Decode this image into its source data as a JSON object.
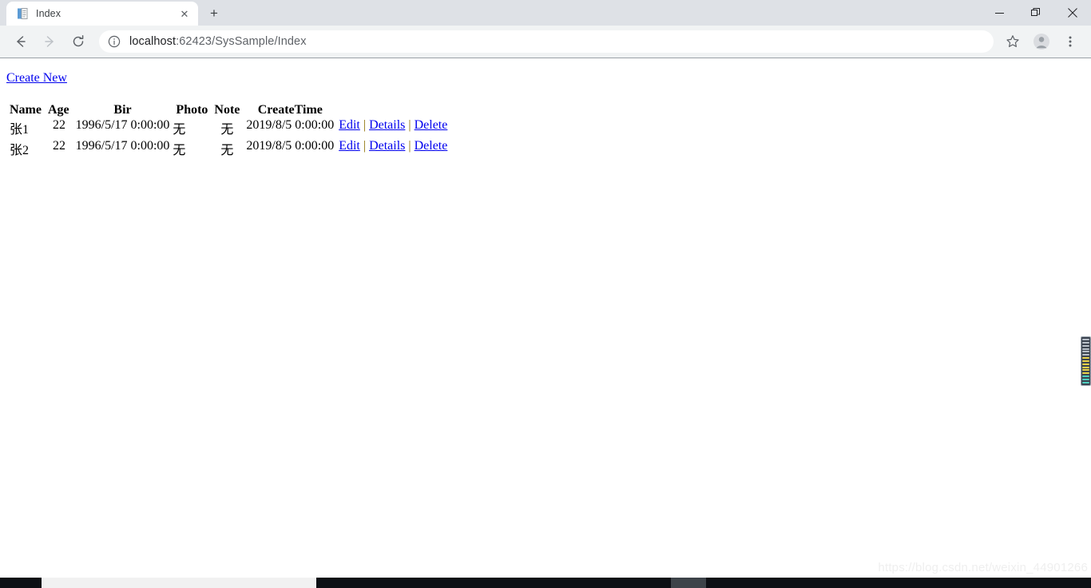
{
  "window": {
    "controls": {
      "minimize": "—",
      "restore": "❐",
      "close": "✕"
    }
  },
  "tab_strip": {
    "tabs": [
      {
        "title": "Index",
        "favicon": "page-icon",
        "close_label": "✕"
      }
    ],
    "new_tab_label": "+"
  },
  "toolbar": {
    "back_label": "←",
    "forward_label": "→",
    "reload_label": "⟳",
    "info_label": "ⓘ",
    "url_host": "localhost",
    "url_rest": ":62423/SysSample/Index",
    "url_full": "localhost:62423/SysSample/Index",
    "bookmark_label": "☆",
    "profile_label": "profile-avatar",
    "menu_label": "⋮"
  },
  "page": {
    "create_new_label": "Create New",
    "table": {
      "headers": [
        "Name",
        "Age",
        "Bir",
        "Photo",
        "Note",
        "CreateTime"
      ],
      "rows": [
        {
          "name": "张1",
          "age": "22",
          "bir": "1996/5/17 0:00:00",
          "photo": "无",
          "note": "无",
          "createtime": "2019/8/5 0:00:00",
          "actions": [
            "Edit",
            "Details",
            "Delete"
          ]
        },
        {
          "name": "张2",
          "age": "22",
          "bir": "1996/5/17 0:00:00",
          "photo": "无",
          "note": "无",
          "createtime": "2019/8/5 0:00:00",
          "actions": [
            "Edit",
            "Details",
            "Delete"
          ]
        }
      ],
      "action_separator": "|"
    },
    "watermark": "https://blog.csdn.net/weixin_44901266"
  },
  "colors": {
    "link": "#0000EE",
    "tab_strip_bg": "#DEE1E6",
    "toolbar_bg": "#F1F3F4",
    "page_bg": "#FFFFFF",
    "separator": "#8A6D00"
  }
}
